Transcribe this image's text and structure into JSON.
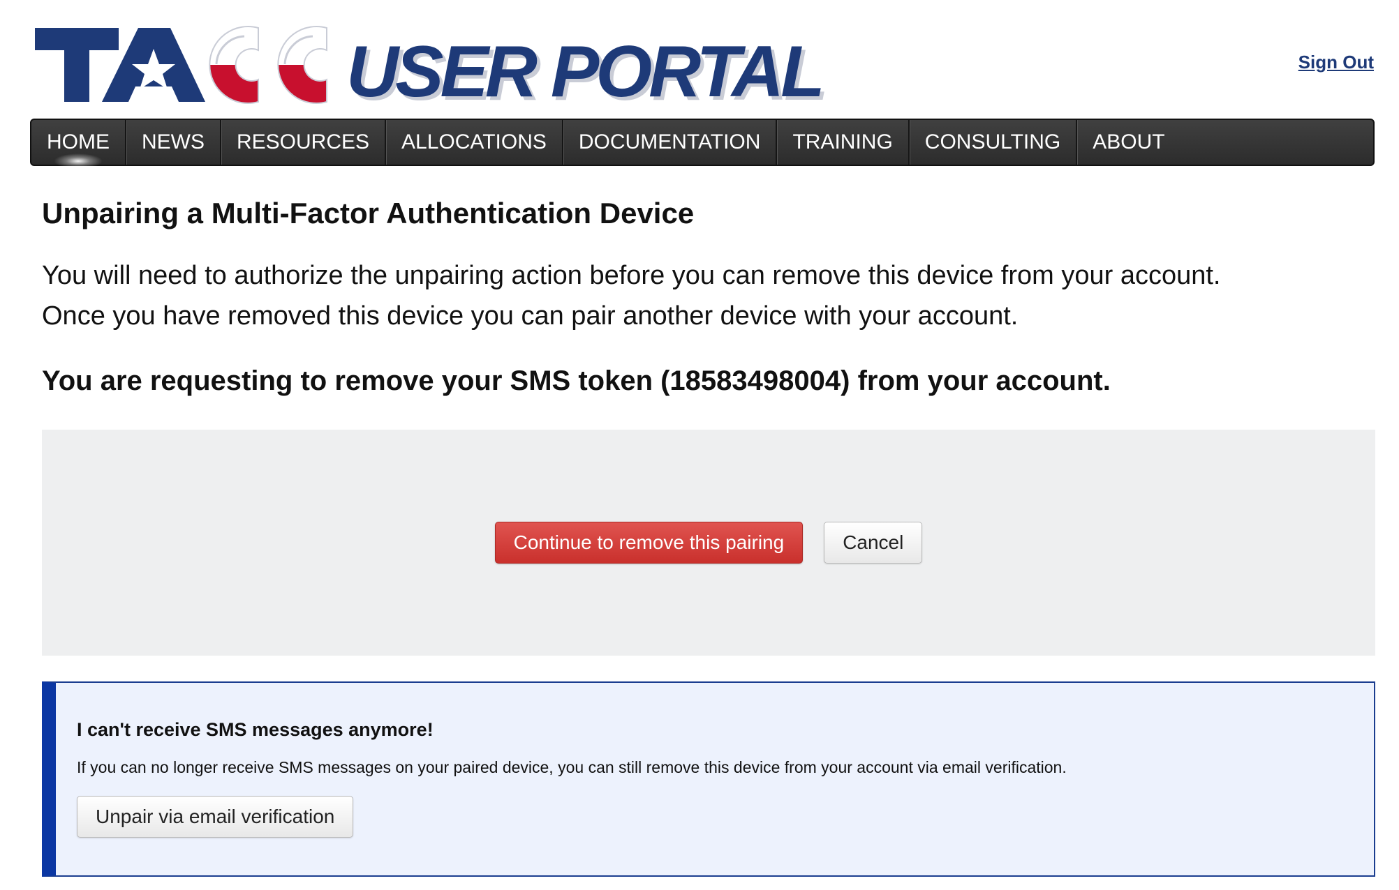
{
  "header": {
    "logo_text_tacc": "TACC",
    "logo_text_portal": "USER PORTAL",
    "sign_out_label": "Sign Out"
  },
  "nav": {
    "items": [
      {
        "label": "HOME",
        "active": true
      },
      {
        "label": "NEWS"
      },
      {
        "label": "RESOURCES"
      },
      {
        "label": "ALLOCATIONS"
      },
      {
        "label": "DOCUMENTATION"
      },
      {
        "label": "TRAINING"
      },
      {
        "label": "CONSULTING"
      },
      {
        "label": "ABOUT"
      }
    ]
  },
  "main": {
    "title": "Unpairing a Multi-Factor Authentication Device",
    "intro_line1": "You will need to authorize the unpairing action before you can remove this device from your account.",
    "intro_line2": "Once you have removed this device you can pair another device with your account.",
    "request_text": "You are requesting to remove your SMS token (18583498004) from your account.",
    "continue_label": "Continue to remove this pairing",
    "cancel_label": "Cancel"
  },
  "sms_help": {
    "title": "I can't receive SMS messages anymore!",
    "description": "If you can no longer receive SMS messages on your paired device, you can still remove this device from your account via email verification.",
    "button_label": "Unpair via email verification"
  },
  "colors": {
    "brand_blue": "#1e3a78",
    "brand_red": "#c8102e",
    "danger_button": "#c9302c",
    "nav_background": "#333333",
    "panel_gray": "#eeeff0",
    "info_box_bg": "#edf2fd",
    "info_box_accent": "#0b37a3"
  },
  "icons": [
    "star-icon"
  ]
}
